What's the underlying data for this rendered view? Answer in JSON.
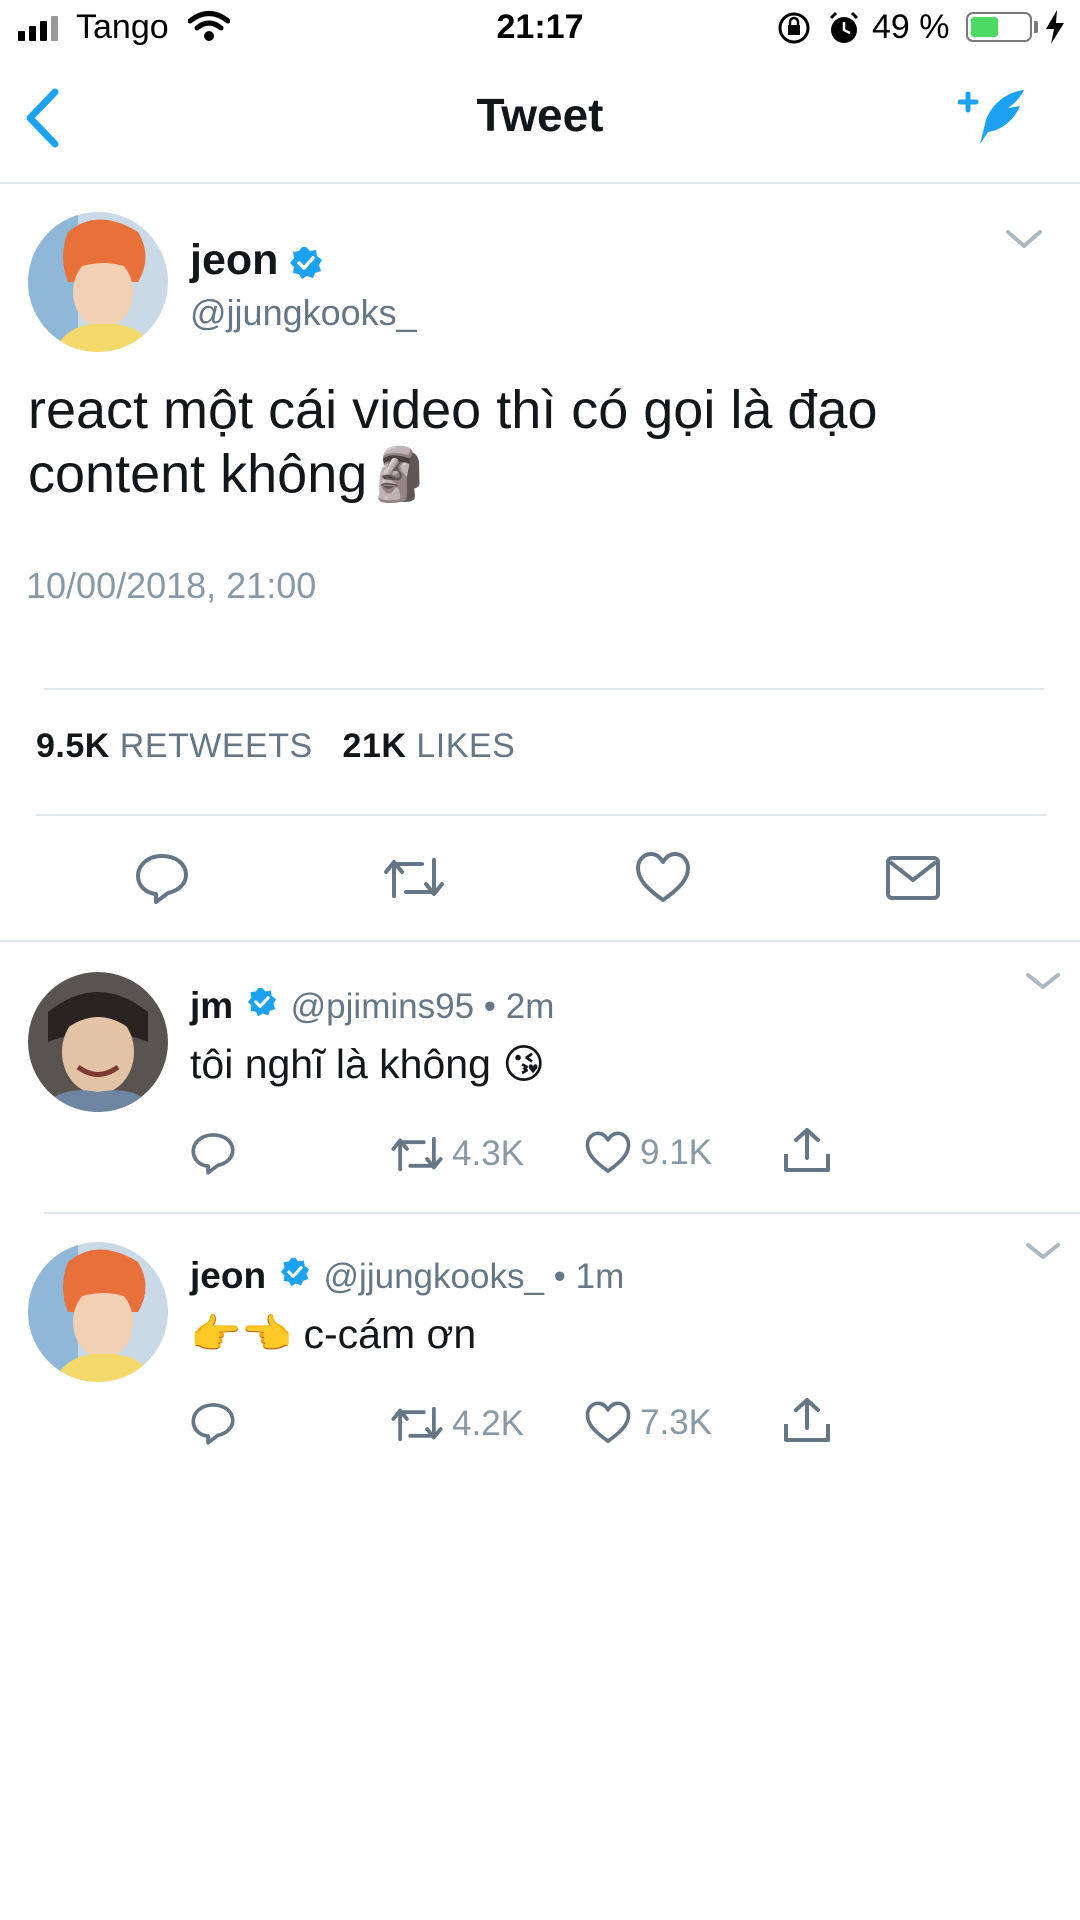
{
  "status_bar": {
    "carrier": "Tango",
    "time": "21:17",
    "battery_percent": "49 %",
    "battery_level": 0.49
  },
  "nav": {
    "title": "Tweet",
    "back_icon": "chevron-left-icon",
    "compose_icon": "compose-tweet-icon"
  },
  "tweet": {
    "name": "jeon",
    "handle": "@jjungkooks_",
    "text_line1": "react một cái video thì có gọi là đạo",
    "text_line2": "content không",
    "emoji": "🗿",
    "timestamp": "10/00/2018, 21:00",
    "retweets_count": "9.5K",
    "retweets_label": "RETWEETS",
    "likes_count": "21K",
    "likes_label": "LIKES",
    "actions": [
      "reply-icon",
      "retweet-icon",
      "like-icon",
      "message-icon"
    ]
  },
  "replies": [
    {
      "name": "jm",
      "handle": "@pjimins95",
      "time": "• 2m",
      "text": "tôi nghĩ là không",
      "emoji": "😘",
      "retweets": "4.3K",
      "likes": "9.1K"
    },
    {
      "name": "jeon",
      "handle": "@jjungkooks_",
      "time": "• 1m",
      "emoji": "👉👈",
      "text": "c-cám ơn",
      "retweets": "4.2K",
      "likes": "7.3K"
    }
  ],
  "colors": {
    "accent": "#1da1f2",
    "text": "#14171a",
    "secondary": "#657786",
    "divider": "#e1e8ed",
    "avatar_bg": "#e8a070"
  }
}
